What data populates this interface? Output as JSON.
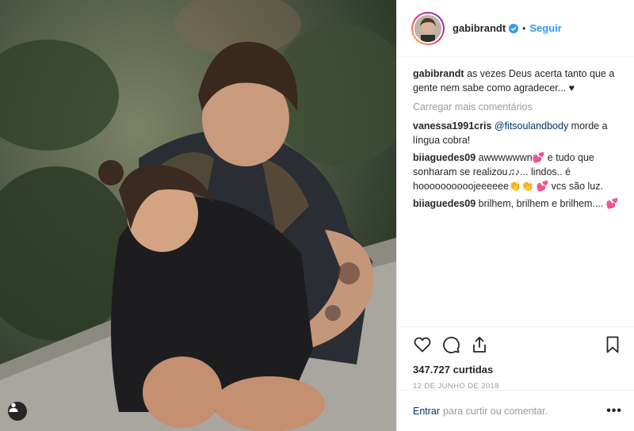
{
  "post": {
    "username": "gabibrandt",
    "follow_label": "Seguir",
    "dot": "•",
    "caption_user": "gabibrandt",
    "caption_text": " as vezes Deus acerta tanto que a gente nem sabe como agradecer... ♥",
    "load_more_label": "Carregar mais comentários",
    "comments": [
      {
        "user": "vanessa1991cris",
        "mention": "@fitsoulandbody",
        "text": " morde a língua cobra!"
      },
      {
        "user": "biiaguedes09",
        "text_a": " awwwwwwn",
        "emoji_a": "💕",
        "text_b": "  e tudo que sonharam se realizou♫♪... lindos.. é hoooooooooojeeeeee",
        "emoji_b": "👏👏",
        "emoji_c": "💕",
        "text_c": "  vcs são luz."
      },
      {
        "user": "biiaguedes09",
        "text": " brilhem, brilhem e brilhem....",
        "emoji": "💕"
      }
    ],
    "likes": "347.727 curtidas",
    "date": "12 de junho de 2018",
    "login_label": "Entrar",
    "add_comment_text": "para curtir ou comentar.",
    "more_label": "•••"
  },
  "icons": {
    "like": "heart-icon",
    "comment": "comment-icon",
    "share": "share-icon",
    "save": "bookmark-icon",
    "verified": "verified-badge-icon",
    "tag": "user-tag-icon"
  },
  "colors": {
    "link": "#3897f0",
    "text": "#262626",
    "muted": "#999999",
    "dark_link": "#003569"
  }
}
